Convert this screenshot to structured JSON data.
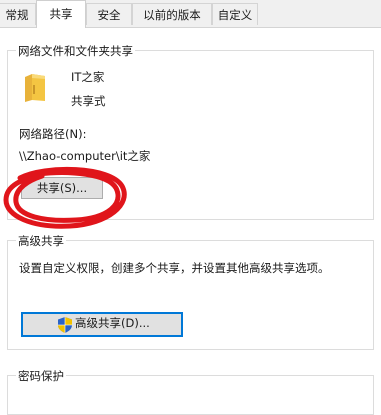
{
  "tabs": [
    {
      "label": "常规",
      "active": false
    },
    {
      "label": "共享",
      "active": true
    },
    {
      "label": "安全",
      "active": false
    },
    {
      "label": "以前的版本",
      "active": false
    },
    {
      "label": "自定义",
      "active": false
    }
  ],
  "network_share": {
    "group_title": "网络文件和文件夹共享",
    "folder_name": "IT之家",
    "share_status": "共享式",
    "path_label": "网络路径(N):",
    "path_value": "\\\\Zhao-computer\\it之家",
    "share_button": "共享(S)..."
  },
  "advanced_share": {
    "group_title": "高级共享",
    "description": "设置自定义权限，创建多个共享，并设置其他高级共享选项。",
    "button": "高级共享(D)..."
  },
  "password": {
    "group_title": "密码保护"
  },
  "colors": {
    "annotation": "#e0151b",
    "focus_border": "#0078d7",
    "folder": "#f4c542"
  }
}
